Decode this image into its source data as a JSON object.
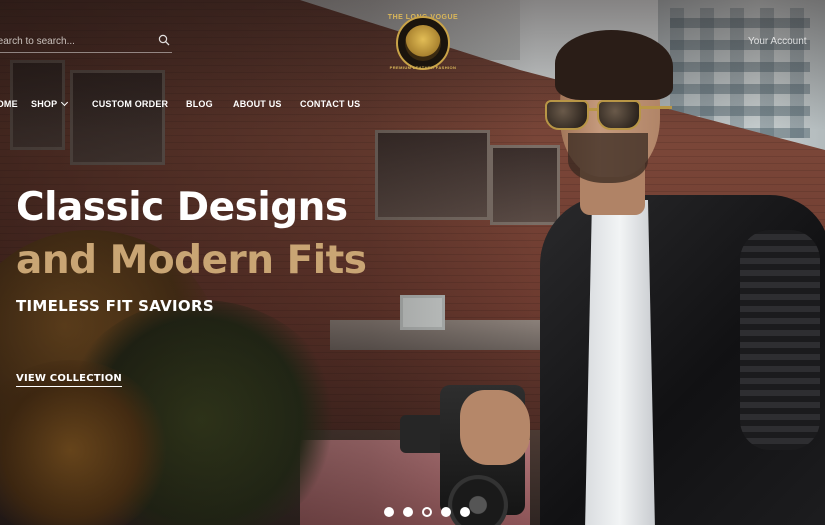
{
  "search": {
    "placeholder": "Search to search..."
  },
  "brand": {
    "top_text": "THE LONG VOGUE",
    "bottom_text": "PREMIUM LEATHER FASHION"
  },
  "header": {
    "account_label": "Your Account"
  },
  "nav": {
    "home": "HOME",
    "shop": "SHOP",
    "custom_order": "CUSTOM ORDER",
    "blog": "BLOG",
    "about": "ABOUT US",
    "contact": "CONTACT US"
  },
  "hero": {
    "headline_line1": "Classic Designs",
    "headline_line2": "and Modern Fits",
    "subheadline": "TIMELESS FIT SAVIORS",
    "cta_label": "VIEW COLLECTION",
    "accent_color": "#c9a574"
  },
  "slider": {
    "count": 5,
    "active_index": 2
  }
}
